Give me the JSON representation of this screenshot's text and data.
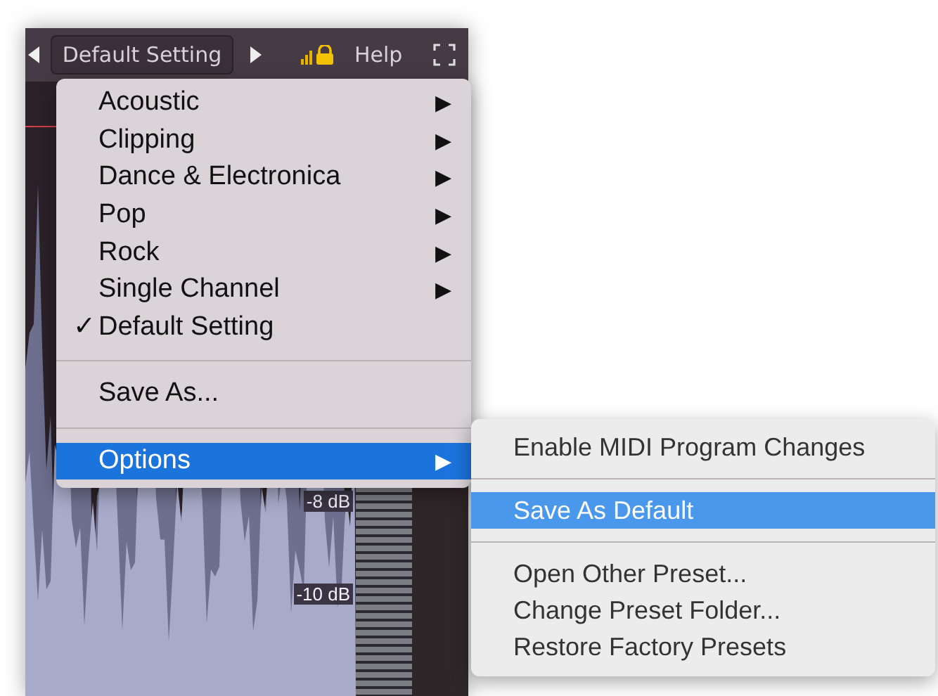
{
  "toolbar": {
    "preset": "Default Setting",
    "help": "Help"
  },
  "display": {
    "db_labels": [
      "-8 dB",
      "-10 dB"
    ]
  },
  "menu": {
    "arrow": "▶",
    "check_mark": "✓",
    "items": [
      {
        "kind": "submenu",
        "label": "Acoustic",
        "selected": false
      },
      {
        "kind": "submenu",
        "label": "Clipping",
        "selected": false
      },
      {
        "kind": "submenu",
        "label": "Dance & Electronica",
        "selected": false
      },
      {
        "kind": "submenu",
        "label": "Pop",
        "selected": false
      },
      {
        "kind": "submenu",
        "label": "Rock",
        "selected": false
      },
      {
        "kind": "submenu",
        "label": "Single Channel",
        "selected": false
      },
      {
        "kind": "item",
        "label": "Default Setting",
        "checked": true,
        "selected": false
      },
      {
        "kind": "separator"
      },
      {
        "kind": "item",
        "label": "Save As...",
        "checked": false,
        "selected": false
      },
      {
        "kind": "separator"
      },
      {
        "kind": "submenu",
        "label": "Options",
        "selected": true
      }
    ]
  },
  "submenu": {
    "items": [
      {
        "kind": "item",
        "label": "Enable MIDI Program Changes",
        "selected": false
      },
      {
        "kind": "separator"
      },
      {
        "kind": "item",
        "label": "Save As Default",
        "selected": true
      },
      {
        "kind": "separator"
      },
      {
        "kind": "item",
        "label": "Open Other Preset...",
        "selected": false
      },
      {
        "kind": "item",
        "label": "Change Preset Folder...",
        "selected": false
      },
      {
        "kind": "item",
        "label": "Restore Factory Presets",
        "selected": false
      }
    ]
  }
}
